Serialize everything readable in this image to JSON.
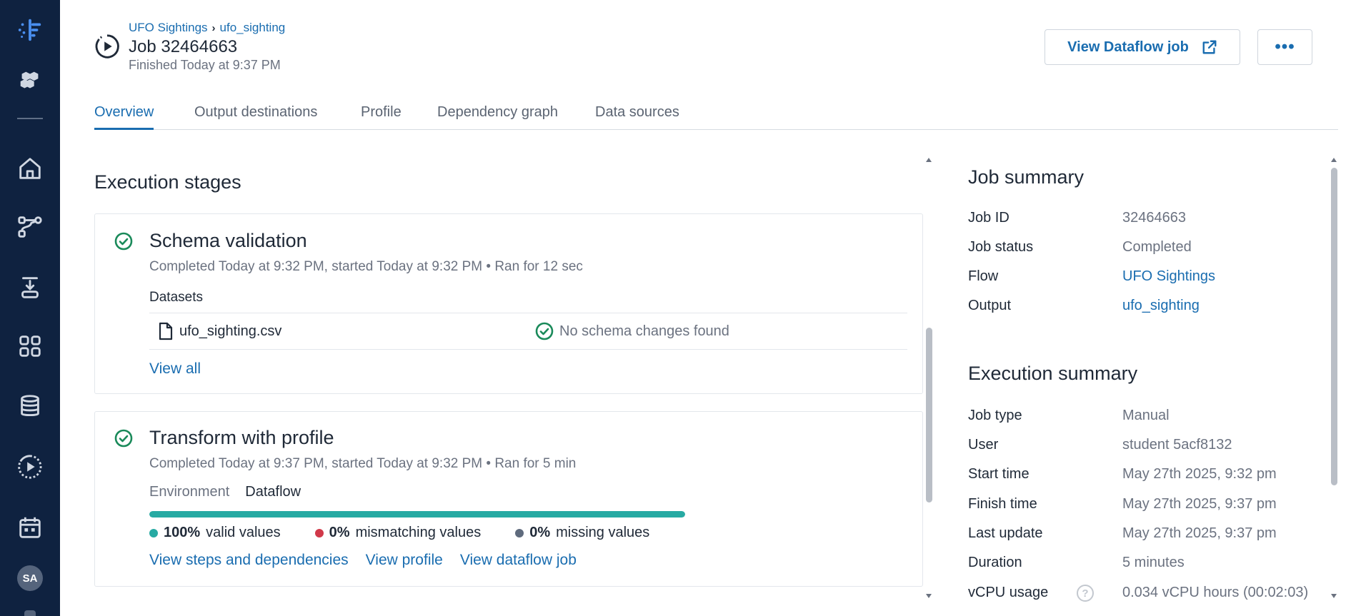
{
  "nav": {
    "items": [
      {
        "name": "logo-icon"
      },
      {
        "name": "hex-cluster-icon"
      },
      {
        "name": "home-icon"
      },
      {
        "name": "flow-icon"
      },
      {
        "name": "import-icon"
      },
      {
        "name": "library-icon"
      },
      {
        "name": "database-icon"
      },
      {
        "name": "jobs-icon"
      },
      {
        "name": "calendar-icon"
      }
    ],
    "avatar": "SA"
  },
  "header": {
    "breadcrumb": [
      "UFO Sightings",
      "ufo_sighting"
    ],
    "title": "Job 32464663",
    "subtitle": "Finished Today at 9:37 PM",
    "dataflow_button": "View Dataflow job",
    "more_button": "•••"
  },
  "tabs": [
    "Overview",
    "Output destinations",
    "Profile",
    "Dependency graph",
    "Data sources"
  ],
  "active_tab": "Overview",
  "execution": {
    "heading": "Execution stages",
    "stages": [
      {
        "title": "Schema validation",
        "meta": "Completed Today at 9:32 PM, started Today at 9:32 PM • Ran for 12 sec",
        "datasets_label": "Datasets",
        "dataset_file": "ufo_sighting.csv",
        "dataset_status": "No schema changes found",
        "view_all": "View all"
      },
      {
        "title": "Transform with profile",
        "meta": "Completed Today at 9:37 PM, started Today at 9:32 PM • Ran for 5 min",
        "environment_label": "Environment",
        "environment_value": "Dataflow",
        "valid_fraction": 1.0,
        "legend": [
          {
            "pct": "100%",
            "label": "valid values",
            "color": "#27aaa3"
          },
          {
            "pct": "0%",
            "label": "mismatching values",
            "color": "#d1394a"
          },
          {
            "pct": "0%",
            "label": "missing values",
            "color": "#5f6b7d"
          }
        ],
        "links": [
          "View steps and dependencies",
          "View profile",
          "View dataflow job"
        ]
      }
    ]
  },
  "job_summary": {
    "heading": "Job summary",
    "rows": [
      {
        "key": "Job ID",
        "value": "32464663"
      },
      {
        "key": "Job status",
        "value": "Completed"
      },
      {
        "key": "Flow",
        "value": "UFO Sightings"
      },
      {
        "key": "Output",
        "value": "ufo_sighting"
      }
    ]
  },
  "execution_summary": {
    "heading": "Execution summary",
    "rows": [
      {
        "key": "Job type",
        "value": "Manual"
      },
      {
        "key": "User",
        "value": "student 5acf8132"
      },
      {
        "key": "Start time",
        "value": "May 27th 2025, 9:32 pm"
      },
      {
        "key": "Finish time",
        "value": "May 27th 2025, 9:37 pm"
      },
      {
        "key": "Last update",
        "value": "May 27th 2025, 9:37 pm"
      },
      {
        "key": "Duration",
        "value": "5 minutes"
      },
      {
        "key": "vCPU usage",
        "value": "0.034 vCPU hours (00:02:03)"
      }
    ],
    "help_glyph": "?"
  },
  "colors": {
    "rail": "#0f2240",
    "accent": "#1a6db0",
    "success": "#1a8a5a",
    "valid": "#27aaa3"
  }
}
